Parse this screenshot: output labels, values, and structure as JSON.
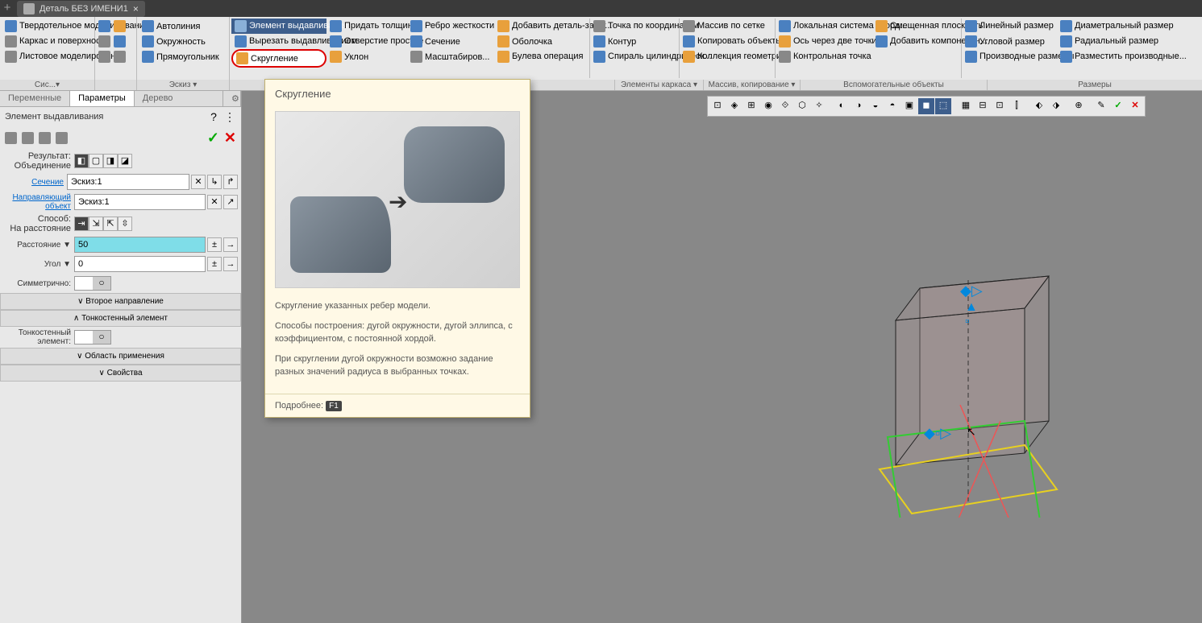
{
  "title_tab": "Деталь БЕЗ ИМЕНИ1",
  "ribbon": {
    "groups": [
      {
        "label": "Сис...▾",
        "items": [
          {
            "t": "Твердотельное моделирование"
          },
          {
            "t": "Каркас и поверхности"
          },
          {
            "t": "Листовое моделирование"
          }
        ]
      },
      {
        "label": "Эскиз ▾",
        "items": [
          {
            "t": "Автолиния"
          },
          {
            "t": "Окружность"
          },
          {
            "t": "Прямоугольник"
          }
        ]
      },
      {
        "label": "",
        "items": [
          {
            "t": "Элемент выдавливания",
            "active": true
          },
          {
            "t": "Вырезать выдавливанием"
          },
          {
            "t": "Скругление",
            "highlighted": true
          },
          {
            "t": "Придать толщину"
          },
          {
            "t": "Отверстие простое"
          },
          {
            "t": "Уклон"
          },
          {
            "t": "Ребро жесткости"
          },
          {
            "t": "Сечение"
          },
          {
            "t": "Масштабиров..."
          },
          {
            "t": "Добавить деталь-загот..."
          },
          {
            "t": "Оболочка"
          },
          {
            "t": "Булева операция"
          }
        ]
      },
      {
        "label": "Элементы каркаса ▾",
        "items": [
          {
            "t": "Точка по координатам"
          },
          {
            "t": "Контур"
          },
          {
            "t": "Спираль цилиндрическ..."
          }
        ]
      },
      {
        "label": "Массив, копирование ▾",
        "items": [
          {
            "t": "Массив по сетке"
          },
          {
            "t": "Копировать объекты"
          },
          {
            "t": "Коллекция геометрии"
          }
        ]
      },
      {
        "label": "Вспомогательные объекты",
        "items": [
          {
            "t": "Локальная система коорд..."
          },
          {
            "t": "Ось через две точки"
          },
          {
            "t": "Контрольная точка"
          },
          {
            "t": "Смещенная плоскость"
          },
          {
            "t": "Добавить компонентн..."
          }
        ]
      },
      {
        "label": "Размеры",
        "items": [
          {
            "t": "Линейный размер"
          },
          {
            "t": "Угловой размер"
          },
          {
            "t": "Производные размеры"
          },
          {
            "t": "Диаметральный размер"
          },
          {
            "t": "Радиальный размер"
          },
          {
            "t": "Разместить производные..."
          }
        ]
      }
    ]
  },
  "sidebar": {
    "tabs": [
      {
        "l": "Переменные"
      },
      {
        "l": "Параметры",
        "active": true
      },
      {
        "l": "Дерево"
      }
    ],
    "panel_title": "Элемент выдавливания",
    "props": {
      "result_label": "Результат:",
      "result_sub": "Объединение",
      "section_label": "Сечение",
      "section_value": "Эскиз:1",
      "guide_label": "Направляющий объект",
      "guide_value": "Эскиз:1",
      "method_label": "Способ:",
      "method_sub": "На расстояние",
      "distance_label": "Расстояние ▼",
      "distance_value": "50",
      "angle_label": "Угол ▼",
      "angle_value": "0",
      "sym_label": "Симметрично:",
      "thin_label": "Тонкостенный элемент:",
      "headers": [
        "Второе направление",
        "Тонкостенный элемент",
        "Область применения",
        "Свойства"
      ]
    }
  },
  "tooltip": {
    "title": "Скругление",
    "p1": "Скругление указанных ребер модели.",
    "p2": "Способы построения: дугой окружности, дугой эллипса, с коэффициентом, с постоянной хордой.",
    "p3": "При скруглении дугой окружности возможно задание разных значений радиуса в выбранных точках.",
    "more": "Подробнее:",
    "key": "F1"
  }
}
